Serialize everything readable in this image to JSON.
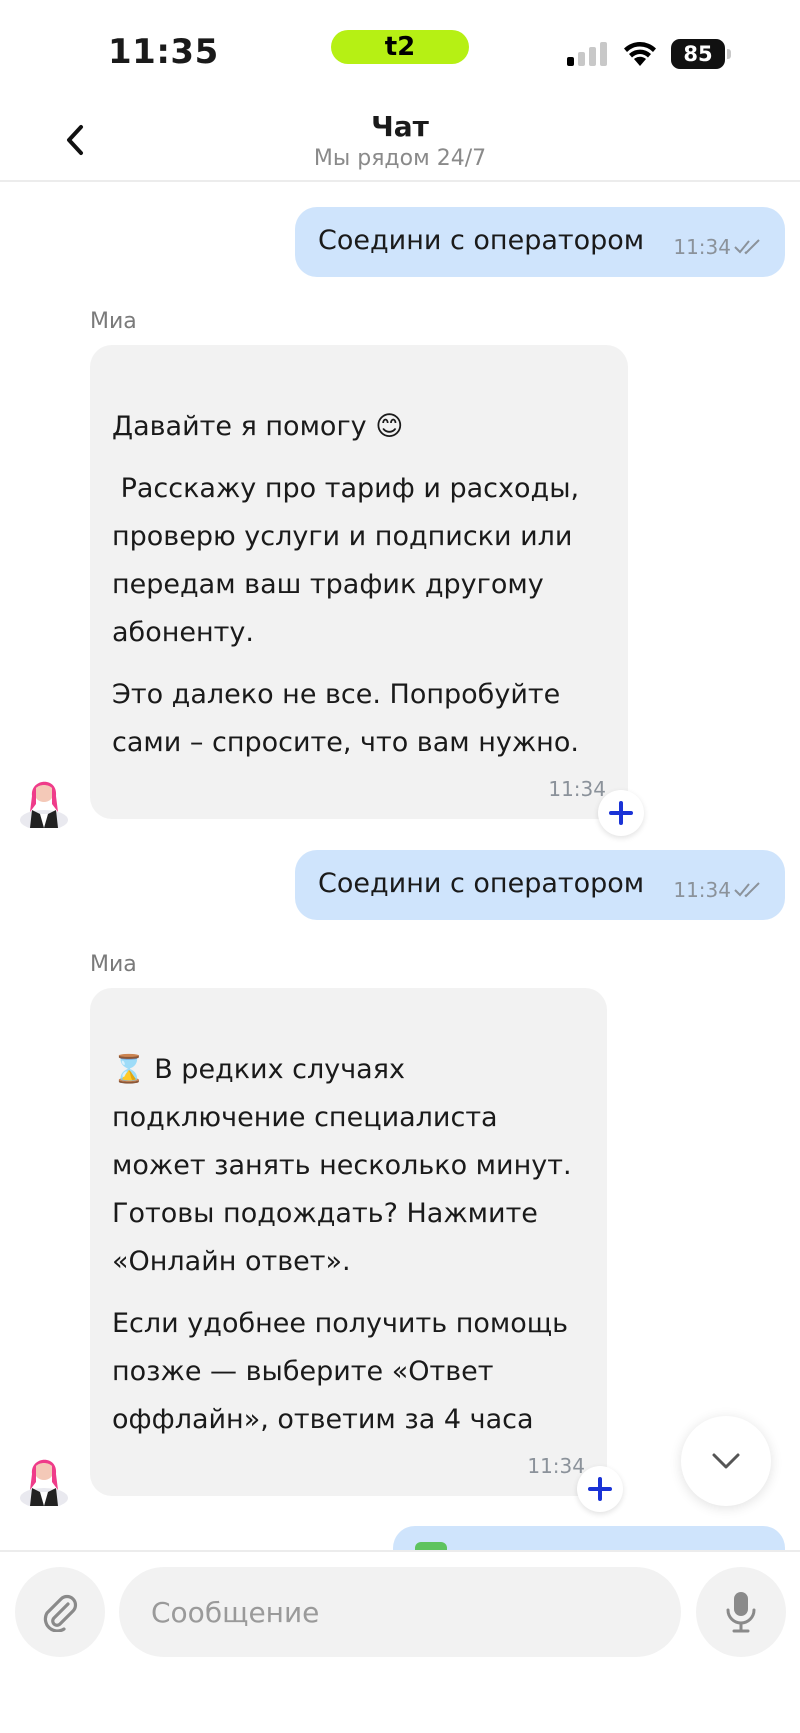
{
  "status_bar": {
    "time": "11:35",
    "carrier": "t2",
    "battery": "85",
    "signal_bars_on": 1,
    "signal_bars_total": 4,
    "carrier_color": "#b6f014"
  },
  "header": {
    "back_icon": "chevron-left-icon",
    "title": "Чат",
    "subtitle": "Мы рядом 24/7"
  },
  "messages": [
    {
      "direction": "outgoing",
      "text": "Соедини с оператором",
      "time": "11:34",
      "status_icon": "double-check-icon"
    },
    {
      "direction": "incoming",
      "sender": "Миа",
      "paragraphs": [
        "Давайте я помогу 😊",
        " Расскажу про тариф и расходы, проверю услуги и подписки или передам ваш трафик другому абоненту.",
        "Это далеко не все. Попробуйте сами – спросите, что вам нужно."
      ],
      "time": "11:34",
      "reaction_icon": "plus-icon"
    },
    {
      "direction": "outgoing",
      "text": "Соедини с оператором",
      "time": "11:34",
      "status_icon": "double-check-icon"
    },
    {
      "direction": "incoming",
      "sender": "Миа",
      "paragraphs": [
        "⌛ В редких случаях подключение специалиста может занять несколько минут. Готовы подождать? Нажмите «Онлайн ответ».",
        "Если удобнее получить помощь позже — выберите «Ответ оффлайн», ответим за 4 часа"
      ],
      "time": "11:34",
      "reaction_icon": "plus-icon"
    }
  ],
  "composer": {
    "attach_icon": "paperclip-icon",
    "placeholder": "Сообщение",
    "mic_icon": "microphone-icon",
    "scroll_down_icon": "chevron-down-icon"
  },
  "colors": {
    "outgoing_bubble": "#cfe4fc",
    "incoming_bubble": "#f2f2f2",
    "accent_plus": "#1a33d6"
  }
}
